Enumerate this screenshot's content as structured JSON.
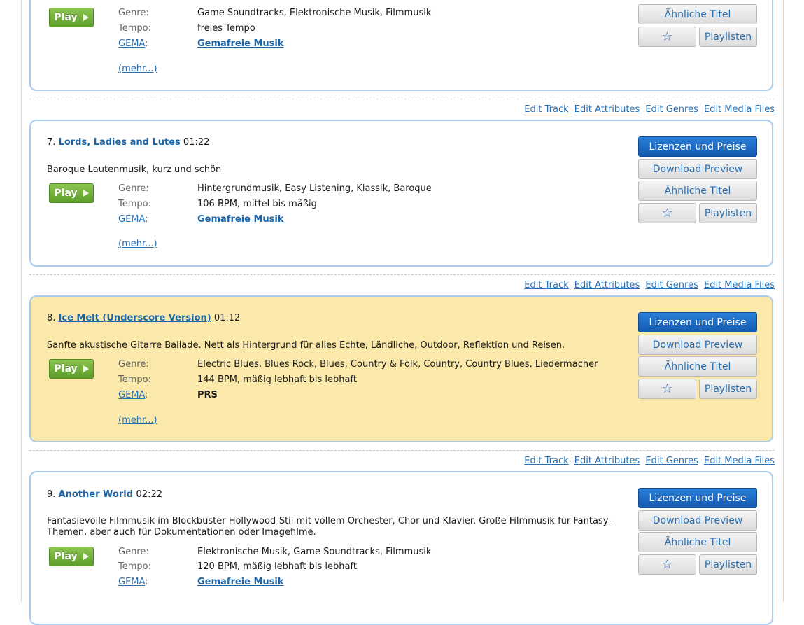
{
  "edit_links": [
    "Edit Track",
    "Edit Attributes",
    "Edit Genres",
    "Edit Media Files"
  ],
  "labels": {
    "genre": "Genre:",
    "tempo": "Tempo:",
    "gema": "GEMA",
    "colon": ":",
    "mehr": "(mehr...)",
    "play": "Play",
    "lizenzen": "Lizenzen und Preise",
    "download": "Download Preview",
    "aehnliche": "Ähnliche Titel",
    "star": "☆",
    "playlisten": "Playlisten"
  },
  "tracks": [
    {
      "genres": "Game Soundtracks, Elektronische Musik, Filmmusik",
      "tempo": "freies Tempo",
      "gema": "Gemafreie Musik"
    },
    {
      "number": "7.",
      "title": "Lords, Ladies and Lutes",
      "duration": "01:22",
      "description": "Baroque Lautenmusik, kurz und schön",
      "genres": "Hintergrundmusik, Easy Listening, Klassik, Baroque",
      "tempo": "106 BPM, mittel bis mäßig",
      "gema": "Gemafreie Musik"
    },
    {
      "number": "8.",
      "title": "Ice Melt (Underscore Version)",
      "duration": "01:12",
      "description": "Sanfte akustische Gitarre Ballade. Nett als Hintergrund für alles Echte, Ländliche, Outdoor, Reflektion und Reisen.",
      "genres": "Electric Blues, Blues Rock, Blues, Country & Folk, Country, Country Blues, Liedermacher",
      "tempo": "144 BPM, mäßig lebhaft bis lebhaft",
      "gema": "PRS"
    },
    {
      "number": "9.",
      "title": "Another World ",
      "duration": "02:22",
      "description": "Fantasievolle Filmmusik im Blockbuster Hollywood-Stil mit vollem Orchester, Chor und Klavier. Große Filmmusik für Fantasy-Themen, aber auch für Dokumentationen oder Imagefilme.",
      "genres": "Elektronische Musik, Game Soundtracks, Filmmusik",
      "tempo": "120 BPM, mäßig lebhaft bis lebhaft",
      "gema": "Gemafreie Musik"
    }
  ],
  "colors": {
    "highlight_bg": "#fae9ab",
    "card_border": "#a9cdef",
    "link": "#2a6fb0",
    "button_blue": "#1f6fc6",
    "play_green": "#6fae37"
  }
}
